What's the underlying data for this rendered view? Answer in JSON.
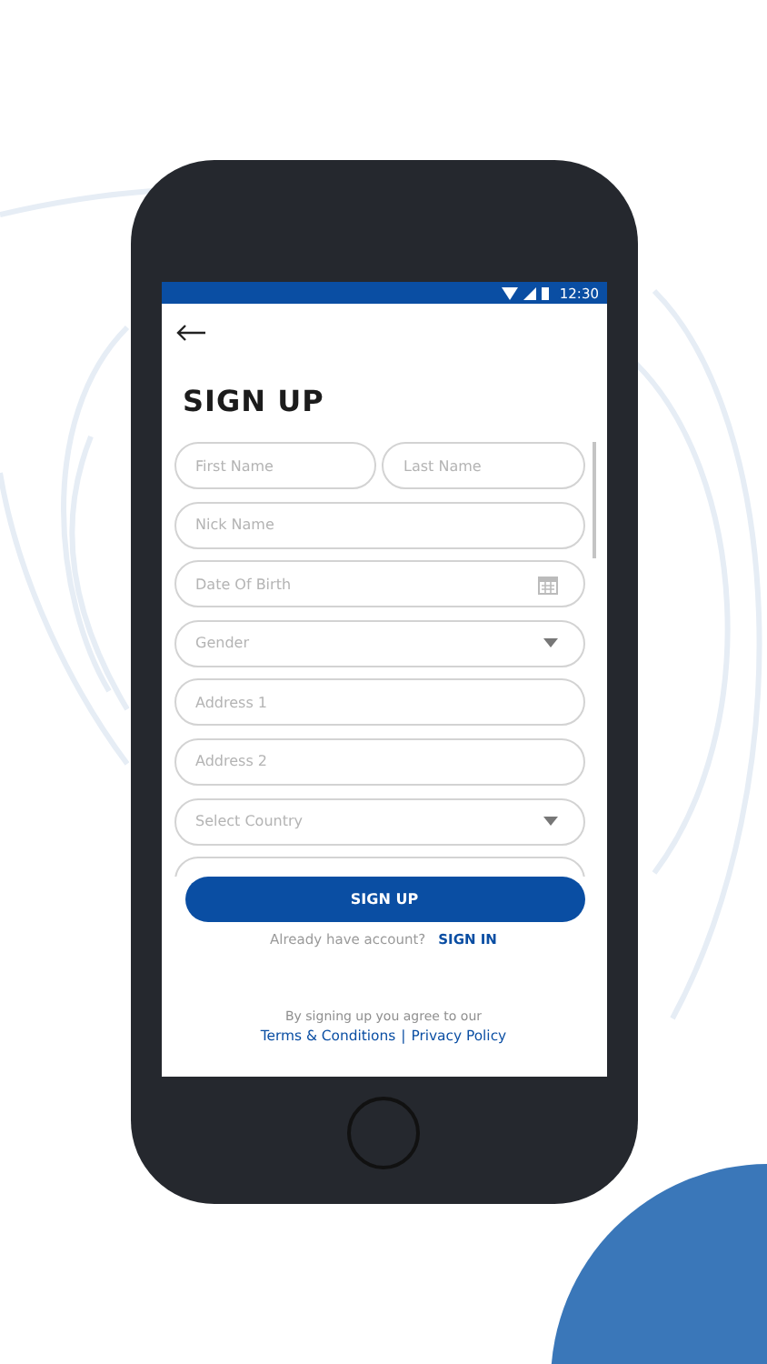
{
  "status_bar": {
    "time": "12:30"
  },
  "title": "SIGN UP",
  "form_rows": [
    [
      {
        "kind": "text",
        "placeholder": "First Name"
      },
      {
        "kind": "text",
        "placeholder": "Last Name"
      }
    ],
    [
      {
        "kind": "text",
        "placeholder": "Nick Name"
      }
    ],
    [
      {
        "kind": "date",
        "placeholder": "Date Of Birth"
      }
    ],
    [
      {
        "kind": "select",
        "placeholder": "Gender"
      }
    ],
    [
      {
        "kind": "text",
        "placeholder": "Address 1"
      }
    ],
    [
      {
        "kind": "text",
        "placeholder": "Address 2"
      }
    ],
    [
      {
        "kind": "select",
        "placeholder": "Select Country"
      }
    ]
  ],
  "submit_button": "SIGN UP",
  "signin_prompt": "Already have account?",
  "signin_link": "SIGN IN",
  "terms_note": "By signing up you agree to our",
  "terms_link": "Terms & Conditions",
  "separator": "|",
  "privacy_link": "Privacy Policy"
}
